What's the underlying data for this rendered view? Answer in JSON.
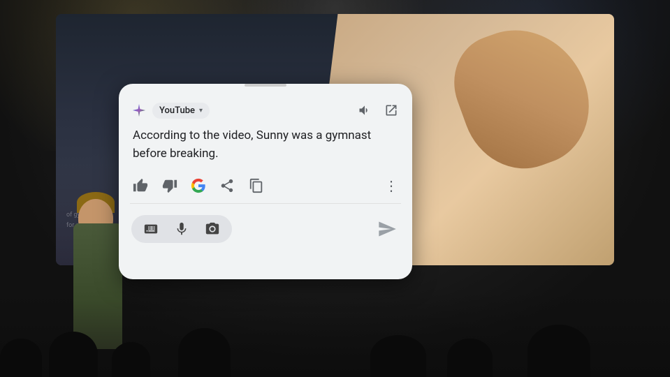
{
  "card": {
    "source": {
      "name": "YouTube",
      "chevron": "▾"
    },
    "response_text": "According to the video, Sunny was a gymnast before breaking.",
    "actions": {
      "thumbs_up": "👍",
      "thumbs_down": "👎",
      "share": "⬆",
      "copy": "⧉",
      "more": "⋮"
    },
    "input": {
      "keyboard_label": "keyboard",
      "mic_label": "microphone",
      "camera_label": "camera"
    },
    "send_label": "send"
  },
  "icons": {
    "speaker": "🔊",
    "external_link": "⬛",
    "gemini_star": "✦",
    "keyboard": "⌨",
    "mic": "🎤",
    "camera": "📷",
    "send": "➤"
  }
}
